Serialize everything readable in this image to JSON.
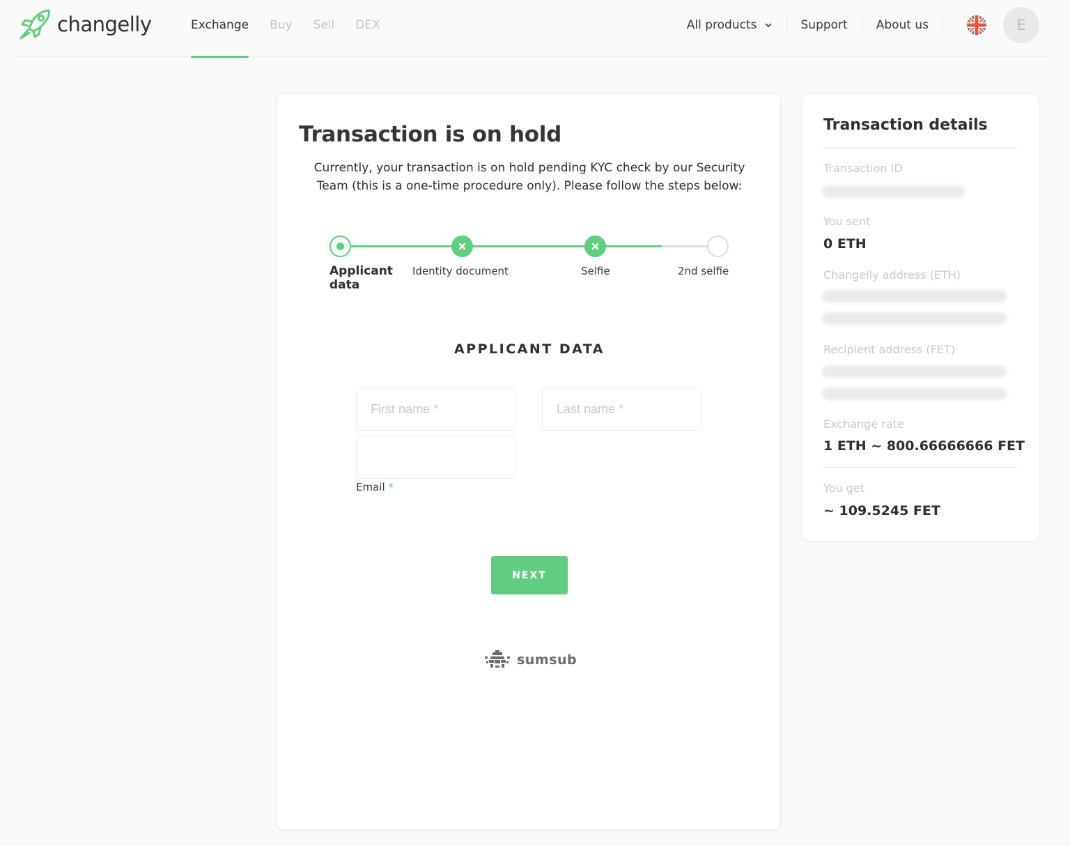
{
  "header": {
    "brand": "changelly",
    "brand_color": "#5ecf7f",
    "nav": [
      {
        "label": "Exchange",
        "active": true
      },
      {
        "label": "Buy",
        "active": false
      },
      {
        "label": "Sell",
        "active": false
      },
      {
        "label": "DEX",
        "active": false
      }
    ],
    "right_nav": {
      "all_products": "All products",
      "support": "Support",
      "about": "About us"
    },
    "language_icon": "uk-flag-icon",
    "avatar_initial": "E"
  },
  "main": {
    "title": "Transaction is on hold",
    "description": "Currently, your transaction is on hold pending KYC check by our Security Team (this is a one-time procedure only). Please follow the steps below:",
    "steps": [
      {
        "label": "Applicant data",
        "state": "current"
      },
      {
        "label": "Identity document",
        "state": "error"
      },
      {
        "label": "Selfie",
        "state": "error"
      },
      {
        "label": "2nd selfie",
        "state": "pending"
      }
    ],
    "section_title": "APPLICANT DATA",
    "form": {
      "first_name_placeholder": "First name *",
      "last_name_placeholder": "Last name *",
      "email_value": "",
      "email_label": "Email",
      "required_mark": "*"
    },
    "next_label": "NEXT",
    "provider": "sumsub"
  },
  "details": {
    "title": "Transaction details",
    "transaction_id_label": "Transaction ID",
    "transaction_id_value": "[blurred]",
    "you_sent_label": "You sent",
    "you_sent_value": "0 ETH",
    "changelly_address_label": "Changelly address (ETH)",
    "changelly_address_value": "[blurred]",
    "recipient_address_label": "Recipient address (FET)",
    "recipient_address_value": "[blurred]",
    "exchange_rate_label": "Exchange rate",
    "exchange_rate_value": "1 ETH ~ 800.66666666 FET",
    "you_get_label": "You get",
    "you_get_value": "~ 109.5245 FET"
  }
}
